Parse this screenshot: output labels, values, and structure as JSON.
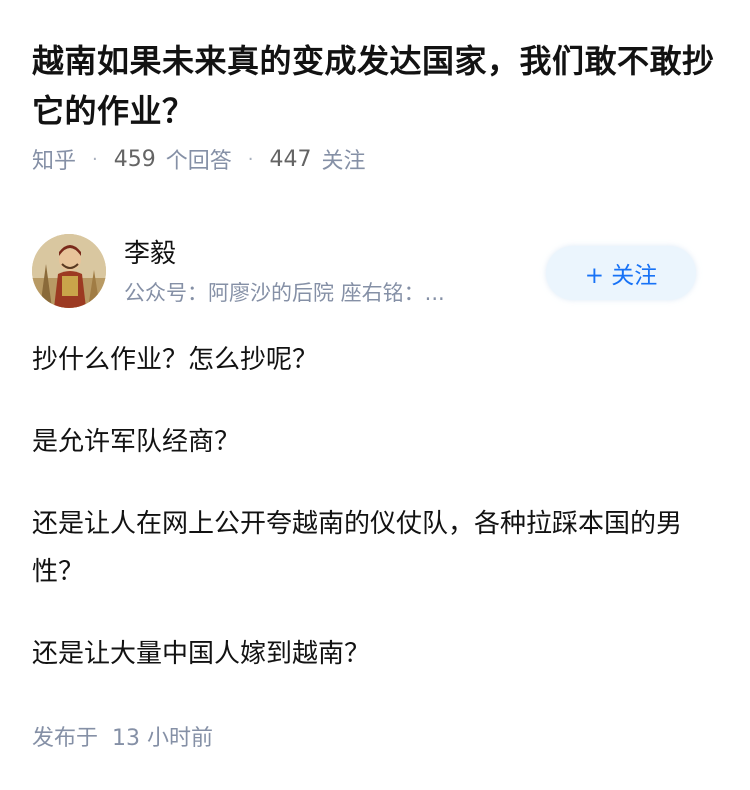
{
  "question": {
    "title": "越南如果未来真的变成发达国家，我们敢不敢抄它的作业？"
  },
  "meta": {
    "source": "知乎",
    "answer_count": "459",
    "answer_word": "个回答",
    "follow_count": "447",
    "follow_word": "关注"
  },
  "author": {
    "name": "李毅",
    "bio": "公众号：阿廖沙的后院 座右铭：...",
    "follow_label": "+ 关注"
  },
  "answer": {
    "paragraphs": [
      "抄什么作业？怎么抄呢？",
      "是允许军队经商？",
      "还是让人在网上公开夸越南的仪仗队，各种拉踩本国的男性？",
      "还是让大量中国人嫁到越南？"
    ]
  },
  "publish": {
    "label": "发布于",
    "time": "13 小时前"
  },
  "colors": {
    "follow_text": "#1772f6",
    "follow_bg": "#ebf5fd",
    "meta_text": "#8590a6"
  }
}
